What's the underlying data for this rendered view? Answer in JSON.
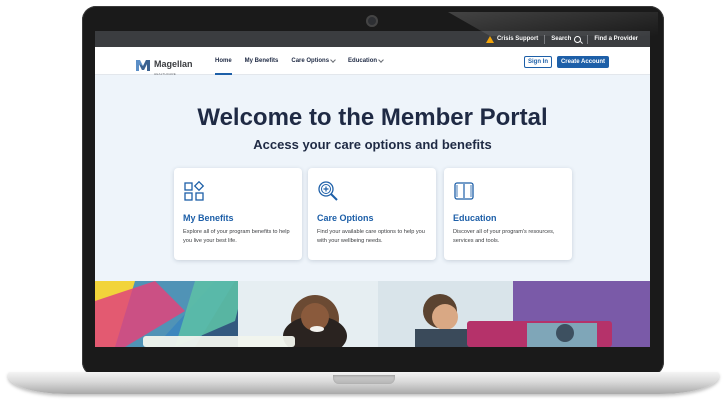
{
  "topbar": {
    "crisis_support": "Crisis Support",
    "search": "Search",
    "find_provider": "Find a Provider"
  },
  "logo": {
    "name": "Magellan",
    "sub": "HEALTHCARE"
  },
  "nav": {
    "items": [
      {
        "label": "Home"
      },
      {
        "label": "My Benefits"
      },
      {
        "label": "Care Options"
      },
      {
        "label": "Education"
      }
    ],
    "sign_in": "Sign In",
    "create_account": "Create Account"
  },
  "hero": {
    "title": "Welcome to the Member Portal",
    "subtitle": "Access your care options and benefits"
  },
  "cards": [
    {
      "title": "My Benefits",
      "desc": "Explore all of your program benefits to help you live your best life.",
      "icon": "grid-shapes-icon"
    },
    {
      "title": "Care Options",
      "desc": "Find your available care options to help you with your wellbeing needs.",
      "icon": "magnifier-plus-icon"
    },
    {
      "title": "Education",
      "desc": "Discover all of your program's resources, services and tools.",
      "icon": "open-book-icon"
    }
  ],
  "colors": {
    "brand_blue": "#1d5fa8",
    "heading": "#1f2a44",
    "topbar": "#3b3d40",
    "warning": "#f0a30a"
  }
}
